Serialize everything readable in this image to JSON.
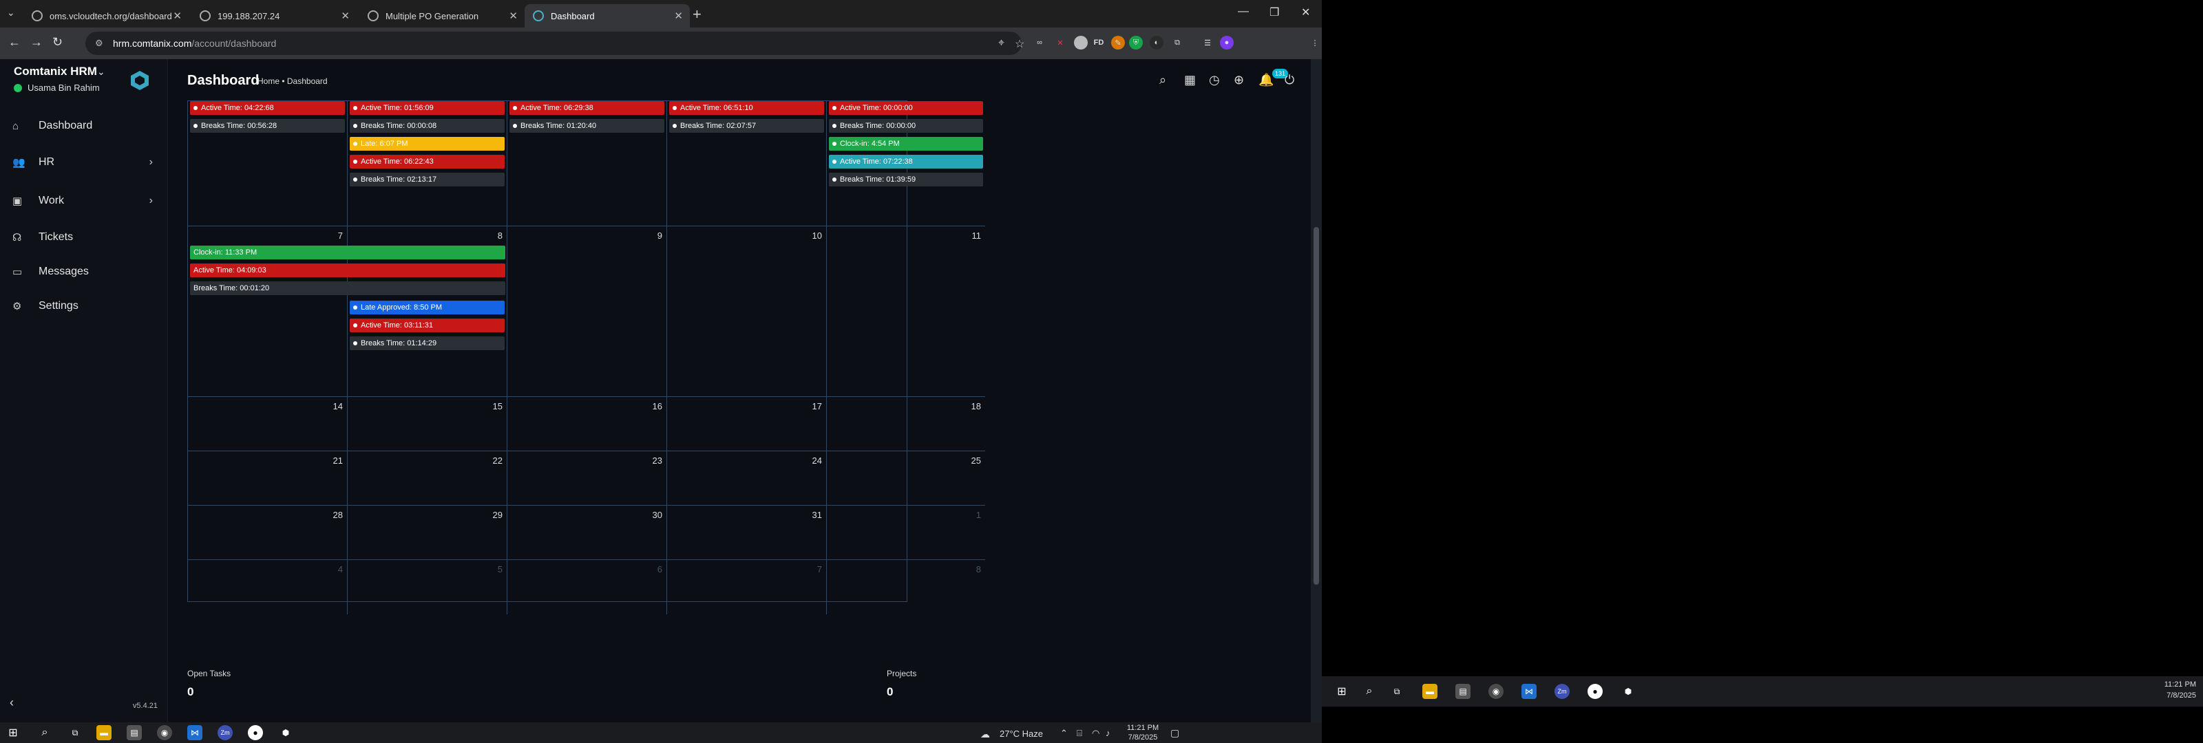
{
  "browser": {
    "tabs": [
      {
        "title": "oms.vcloudtech.org/dashboard",
        "active": false
      },
      {
        "title": "199.188.207.24",
        "active": false
      },
      {
        "title": "Multiple PO Generation",
        "active": false
      },
      {
        "title": "Dashboard",
        "active": true
      }
    ],
    "url_host": "hrm.comtanix.com",
    "url_path": "/account/dashboard"
  },
  "sidebar": {
    "brand": "Comtanix HRM",
    "user": "Usama Bin Rahim",
    "items": [
      {
        "label": "Dashboard",
        "icon": "home-icon",
        "chevron": false
      },
      {
        "label": "HR",
        "icon": "users-icon",
        "chevron": true
      },
      {
        "label": "Work",
        "icon": "briefcase-icon",
        "chevron": true
      },
      {
        "label": "Tickets",
        "icon": "headset-icon",
        "chevron": false
      },
      {
        "label": "Messages",
        "icon": "chat-icon",
        "chevron": false
      },
      {
        "label": "Settings",
        "icon": "gear-icon",
        "chevron": false
      }
    ],
    "version": "v5.4.21"
  },
  "header": {
    "title": "Dashboard",
    "breadcrumb": "Home • Dashboard",
    "notification_count": "131"
  },
  "calendar": {
    "weeks": [
      [
        {
          "day": "",
          "muted": false,
          "events": [
            {
              "text": "Active Time: 04:22:68",
              "color": "red"
            },
            {
              "text": "Breaks Time: 00:56:28",
              "color": "gray"
            }
          ]
        },
        {
          "day": "",
          "muted": false,
          "events": [
            {
              "text": "Active Time: 01:56:09",
              "color": "red"
            },
            {
              "text": "Breaks Time: 00:00:08",
              "color": "gray"
            },
            {
              "text": "Late: 6:07 PM",
              "color": "yellow"
            },
            {
              "text": "Active Time: 06:22:43",
              "color": "red"
            },
            {
              "text": "Breaks Time: 02:13:17",
              "color": "gray"
            }
          ]
        },
        {
          "day": "",
          "muted": false,
          "events": [
            {
              "text": "Active Time: 06:29:38",
              "color": "red"
            },
            {
              "text": "Breaks Time: 01:20:40",
              "color": "gray"
            }
          ]
        },
        {
          "day": "",
          "muted": false,
          "events": [
            {
              "text": "Active Time: 06:51:10",
              "color": "red"
            },
            {
              "text": "Breaks Time: 02:07:57",
              "color": "gray"
            }
          ]
        },
        {
          "day": "",
          "muted": false,
          "events": [
            {
              "text": "Active Time: 00:00:00",
              "color": "red"
            },
            {
              "text": "Breaks Time: 00:00:00",
              "color": "gray"
            },
            {
              "text": "Clock-in: 4:54 PM",
              "color": "green"
            },
            {
              "text": "Active Time: 07:22:38",
              "color": "teal"
            },
            {
              "text": "Breaks Time: 01:39:59",
              "color": "gray"
            }
          ]
        }
      ],
      [
        {
          "day": "7",
          "muted": false,
          "events": []
        },
        {
          "day": "8",
          "muted": false,
          "events": [
            {
              "text": "Late Approved: 8:50 PM",
              "color": "blue"
            },
            {
              "text": "Active Time: 03:11:31",
              "color": "red"
            },
            {
              "text": "Breaks Time: 01:14:29",
              "color": "gray"
            }
          ]
        },
        {
          "day": "9",
          "muted": false,
          "events": []
        },
        {
          "day": "10",
          "muted": false,
          "events": []
        },
        {
          "day": "11",
          "muted": false,
          "events": []
        }
      ],
      [
        {
          "day": "14",
          "muted": false,
          "events": []
        },
        {
          "day": "15",
          "muted": false,
          "events": []
        },
        {
          "day": "16",
          "muted": false,
          "events": []
        },
        {
          "day": "17",
          "muted": false,
          "events": []
        },
        {
          "day": "18",
          "muted": false,
          "events": []
        }
      ],
      [
        {
          "day": "21",
          "muted": false,
          "events": []
        },
        {
          "day": "22",
          "muted": false,
          "events": []
        },
        {
          "day": "23",
          "muted": false,
          "events": []
        },
        {
          "day": "24",
          "muted": false,
          "events": []
        },
        {
          "day": "25",
          "muted": false,
          "events": []
        }
      ],
      [
        {
          "day": "28",
          "muted": false,
          "events": []
        },
        {
          "day": "29",
          "muted": false,
          "events": []
        },
        {
          "day": "30",
          "muted": false,
          "events": []
        },
        {
          "day": "31",
          "muted": false,
          "events": []
        },
        {
          "day": "1",
          "muted": true,
          "events": []
        }
      ],
      [
        {
          "day": "4",
          "muted": true,
          "events": []
        },
        {
          "day": "5",
          "muted": true,
          "events": []
        },
        {
          "day": "6",
          "muted": true,
          "events": []
        },
        {
          "day": "7",
          "muted": true,
          "events": []
        },
        {
          "day": "8",
          "muted": true,
          "events": []
        }
      ]
    ],
    "spanning_events": [
      {
        "text": "Clock-in: 11:33 PM",
        "color": "green"
      },
      {
        "text": "Active Time: 04:09:03",
        "color": "red"
      },
      {
        "text": "Breaks Time: 00:01:20",
        "color": "gray"
      }
    ]
  },
  "stats": {
    "open_tasks_label": "Open Tasks",
    "open_tasks_value": "0",
    "projects_label": "Projects",
    "projects_value": "0"
  },
  "taskbar_main": {
    "weather": "27°C  Haze",
    "time": "11:21 PM",
    "date": "7/8/2025"
  },
  "taskbar_secondary": {
    "time": "11:21 PM",
    "date": "7/8/2025"
  },
  "colors": {
    "red": "#c81717",
    "gray": "#2b3036",
    "yellow": "#f5b80b",
    "green": "#1fa647",
    "teal": "#26a6b5",
    "blue": "#1465e6",
    "grid": "#2c4a66"
  }
}
